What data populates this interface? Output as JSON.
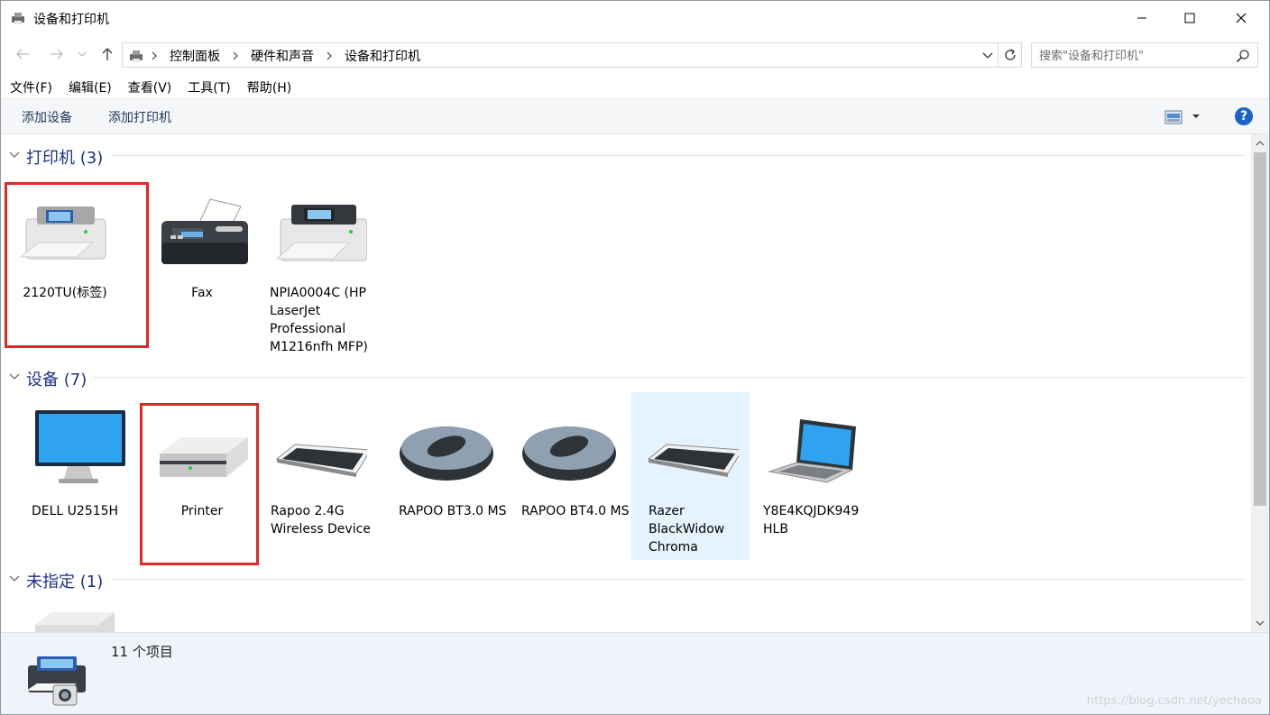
{
  "window": {
    "title": "设备和打印机"
  },
  "address": {
    "crumbs": [
      "控制面板",
      "硬件和声音",
      "设备和打印机"
    ],
    "search_placeholder": "搜索\"设备和打印机\""
  },
  "menu": [
    "文件(F)",
    "编辑(E)",
    "查看(V)",
    "工具(T)",
    "帮助(H)"
  ],
  "commands": {
    "add_device": "添加设备",
    "add_printer": "添加打印机",
    "help": "?"
  },
  "groups": [
    {
      "title": "打印机 (3)",
      "items": [
        {
          "label": "2120TU(标签)",
          "icon": "label-printer-icon"
        },
        {
          "label": "Fax",
          "icon": "fax-icon"
        },
        {
          "label": "NPIA0004C (HP LaserJet Professional M1216nfh MFP)",
          "icon": "laser-printer-icon"
        }
      ]
    },
    {
      "title": "设备 (7)",
      "items": [
        {
          "label": "DELL U2515H",
          "icon": "monitor-icon"
        },
        {
          "label": "Printer",
          "icon": "generic-device-icon"
        },
        {
          "label": "Rapoo 2.4G Wireless Device",
          "icon": "keyboard-icon"
        },
        {
          "label": "RAPOO BT3.0 MS",
          "icon": "mouse-icon"
        },
        {
          "label": "RAPOO BT4.0 MS",
          "icon": "mouse-icon"
        },
        {
          "label": "Razer BlackWidow Chroma",
          "icon": "keyboard-icon",
          "selected": true
        },
        {
          "label": "Y8E4KQJDK949 HLB",
          "icon": "laptop-icon"
        }
      ]
    },
    {
      "title": "未指定 (1)",
      "items": []
    }
  ],
  "status": {
    "count": "11 个项目"
  },
  "watermark": "https://blog.csdn.net/yechaoa"
}
